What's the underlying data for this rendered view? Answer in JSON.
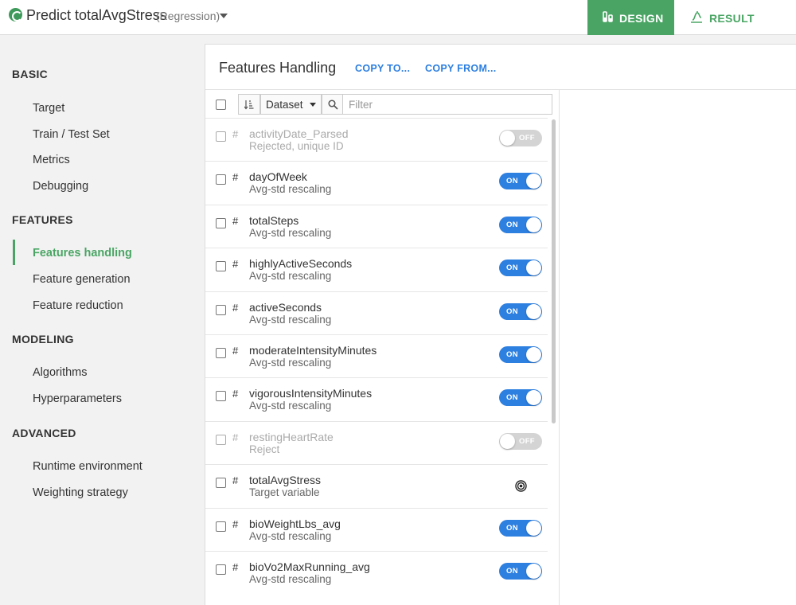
{
  "header": {
    "title": "Predict totalAvgStress",
    "subtitle": "(Regression)",
    "tabs": {
      "design": "DESIGN",
      "result": "RESULT"
    }
  },
  "sidebar": {
    "sections": [
      {
        "title": "BASIC",
        "items": [
          "Target",
          "Train / Test Set",
          "Metrics",
          "Debugging"
        ]
      },
      {
        "title": "FEATURES",
        "items": [
          "Features handling",
          "Feature generation",
          "Feature reduction"
        ]
      },
      {
        "title": "MODELING",
        "items": [
          "Algorithms",
          "Hyperparameters"
        ]
      },
      {
        "title": "ADVANCED",
        "items": [
          "Runtime environment",
          "Weighting strategy"
        ]
      }
    ],
    "active_item": "Features handling"
  },
  "panel": {
    "title": "Features Handling",
    "copy_to": "COPY TO...",
    "copy_from": "COPY FROM...",
    "filter": {
      "dataset_label": "Dataset",
      "placeholder": "Filter"
    },
    "features": [
      {
        "type": "#",
        "name": "activityDate_Parsed",
        "desc": "Rejected, unique ID",
        "state": "OFF"
      },
      {
        "type": "#",
        "name": "dayOfWeek",
        "desc": "Avg-std rescaling",
        "state": "ON"
      },
      {
        "type": "#",
        "name": "totalSteps",
        "desc": "Avg-std rescaling",
        "state": "ON"
      },
      {
        "type": "#",
        "name": "highlyActiveSeconds",
        "desc": "Avg-std rescaling",
        "state": "ON"
      },
      {
        "type": "#",
        "name": "activeSeconds",
        "desc": "Avg-std rescaling",
        "state": "ON"
      },
      {
        "type": "#",
        "name": "moderateIntensityMinutes",
        "desc": "Avg-std rescaling",
        "state": "ON"
      },
      {
        "type": "#",
        "name": "vigorousIntensityMinutes",
        "desc": "Avg-std rescaling",
        "state": "ON"
      },
      {
        "type": "#",
        "name": "restingHeartRate",
        "desc": "Reject",
        "state": "OFF"
      },
      {
        "type": "#",
        "name": "totalAvgStress",
        "desc": "Target variable",
        "state": "TARGET"
      },
      {
        "type": "#",
        "name": "bioWeightLbs_avg",
        "desc": "Avg-std rescaling",
        "state": "ON"
      },
      {
        "type": "#",
        "name": "bioVo2MaxRunning_avg",
        "desc": "Avg-std rescaling",
        "state": "ON"
      }
    ]
  },
  "colors": {
    "accent_green": "#4aa564",
    "link_blue": "#2d7fe0",
    "toggle_off": "#d4d4d4"
  }
}
